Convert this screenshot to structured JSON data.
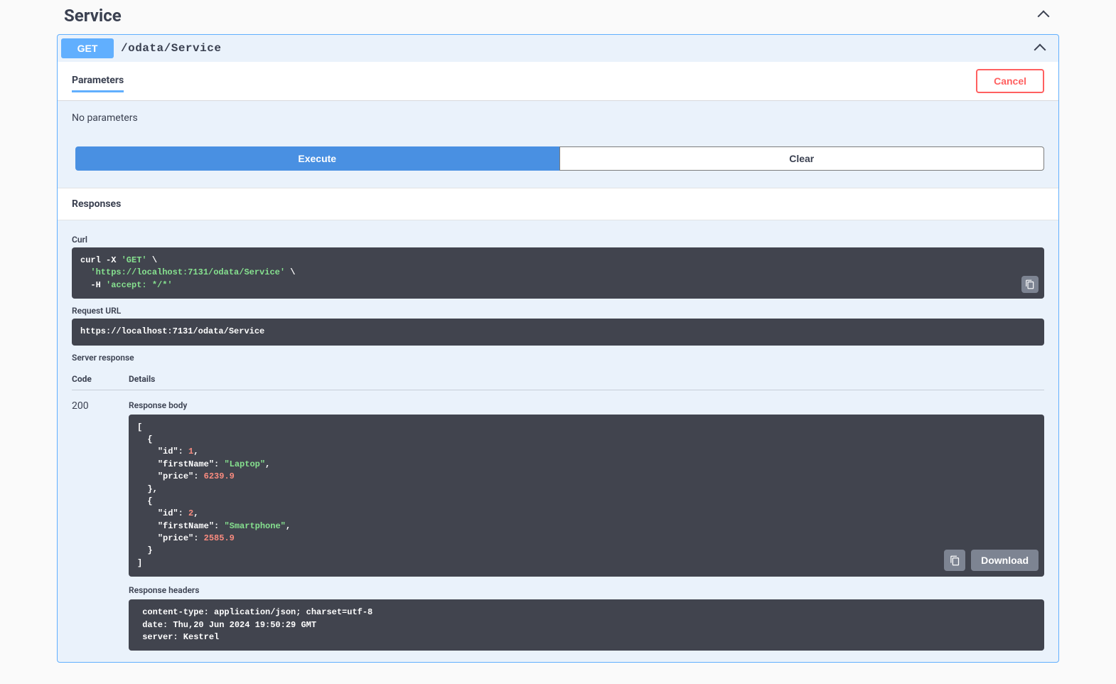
{
  "section": {
    "title": "Service"
  },
  "operation": {
    "method": "GET",
    "path": "/odata/Service"
  },
  "tabs": {
    "parameters": "Parameters"
  },
  "buttons": {
    "cancel": "Cancel",
    "execute": "Execute",
    "clear": "Clear",
    "download": "Download"
  },
  "labels": {
    "no_params": "No parameters",
    "responses": "Responses",
    "curl": "Curl",
    "request_url": "Request URL",
    "server_response": "Server response",
    "code": "Code",
    "details": "Details",
    "response_body": "Response body",
    "response_headers": "Response headers"
  },
  "curl": {
    "prefix": "curl -X ",
    "method_q": "'GET'",
    "cont1": " \\",
    "indent1": "  ",
    "url_q": "'https://localhost:7131/odata/Service'",
    "cont2": " \\",
    "indent2": "  -H ",
    "accept_q": "'accept: */*'"
  },
  "request_url": "https://localhost:7131/odata/Service",
  "status_code": "200",
  "body": {
    "l0": "[",
    "l1": "  {",
    "k_id": "\"id\"",
    "v_id1": "1",
    "k_fn": "\"firstName\"",
    "v_fn1": "\"Laptop\"",
    "k_pr": "\"price\"",
    "v_pr1": "6239.9",
    "l5": "  },",
    "l6": "  {",
    "v_id2": "2",
    "v_fn2": "\"Smartphone\"",
    "v_pr2": "2585.9",
    "l10": "  }",
    "l11": "]",
    "pad": "    ",
    "colon": ": ",
    "comma": ","
  },
  "headers_text": " content-type: application/json; charset=utf-8 \n date: Thu,20 Jun 2024 19:50:29 GMT \n server: Kestrel "
}
